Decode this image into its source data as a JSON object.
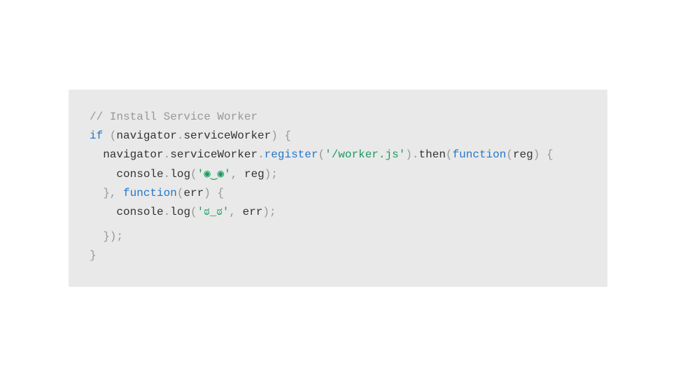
{
  "code": {
    "line1_comment": "// Install Service Worker",
    "line2_if": "if",
    "line2_lparen": " (",
    "line2_navigator": "navigator",
    "line2_dot": ".",
    "line2_serviceWorker": "serviceWorker",
    "line2_rparen_brace": ") {",
    "line3_indent": "  ",
    "line3_navigator": "navigator",
    "line3_dot1": ".",
    "line3_serviceWorker": "serviceWorker",
    "line3_dot2": ".",
    "line3_register": "register",
    "line3_lparen": "(",
    "line3_string": "'/worker.js'",
    "line3_rparen_dot": ").",
    "line3_then": "then",
    "line3_lparen2": "(",
    "line3_function": "function",
    "line3_lparen3": "(",
    "line3_reg": "reg",
    "line3_rparen_brace": ") {",
    "line4_indent": "    ",
    "line4_console": "console",
    "line4_dot": ".",
    "line4_log": "log",
    "line4_lparen": "(",
    "line4_string": "'◉‿◉'",
    "line4_comma": ", ",
    "line4_reg": "reg",
    "line4_rparen_semi": ");",
    "line5_indent": "  ",
    "line5_rbrace_comma": "}, ",
    "line5_function": "function",
    "line5_lparen": "(",
    "line5_err": "err",
    "line5_rparen_brace": ") {",
    "line6_indent": "    ",
    "line6_console": "console",
    "line6_dot": ".",
    "line6_log": "log",
    "line6_lparen": "(",
    "line6_string": "'ಠ_ಠ'",
    "line6_comma": ", ",
    "line6_err": "err",
    "line6_rparen_semi": ");",
    "line7_indent": "  ",
    "line7_close": "});",
    "line8_close": "}"
  }
}
